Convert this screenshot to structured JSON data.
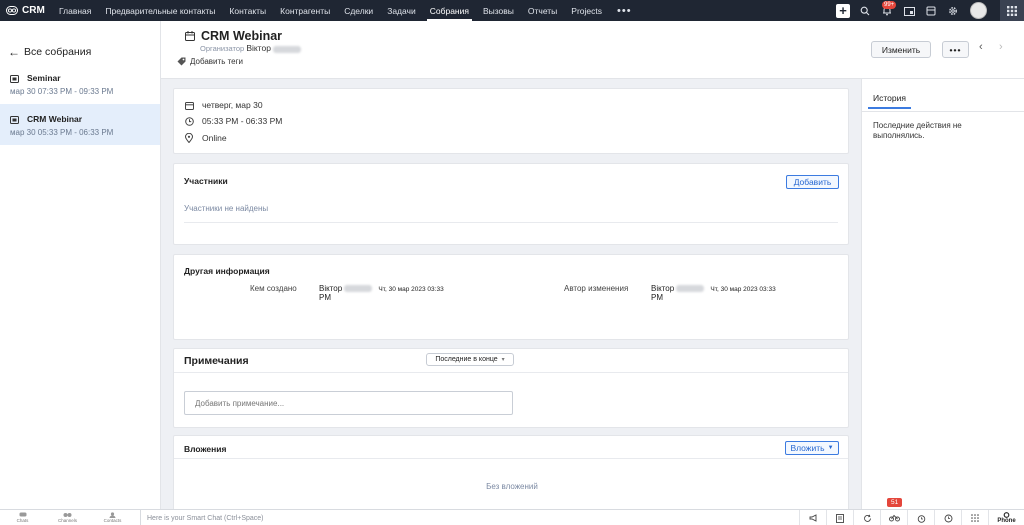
{
  "app": {
    "name": "CRM"
  },
  "nav": {
    "items": [
      {
        "label": "Главная"
      },
      {
        "label": "Предварительные контакты"
      },
      {
        "label": "Контакты"
      },
      {
        "label": "Контрагенты"
      },
      {
        "label": "Сделки"
      },
      {
        "label": "Задачи"
      },
      {
        "label": "Собрания"
      },
      {
        "label": "Вызовы"
      },
      {
        "label": "Отчеты"
      },
      {
        "label": "Projects"
      }
    ],
    "active_index": 6,
    "more": "•••"
  },
  "topbar": {
    "notifications_badge": "99+",
    "add_symbol": "+"
  },
  "left_panel": {
    "back_label": "Все собрания",
    "items": [
      {
        "title": "Seminar",
        "time": "мар 30 07:33 PM - 09:33 PM"
      },
      {
        "title": "CRM Webinar",
        "time": "мар 30 05:33 PM - 06:33 PM"
      }
    ]
  },
  "header": {
    "title": "CRM Webinar",
    "owner_label": "Организатор",
    "owner_name": "Віктор",
    "add_tags": "Добавить теги",
    "edit_button": "Изменить",
    "more_button": "•••",
    "prev_arrow": "‹",
    "next_arrow": "›"
  },
  "details": {
    "date": "четверг, мар 30",
    "time": "05:33 PM - 06:33 PM",
    "location": "Online"
  },
  "participants": {
    "title": "Участники",
    "add_button": "Добавить",
    "empty": "Участники не найдены"
  },
  "other_info": {
    "title": "Другая информация",
    "created_by_label": "Кем создано",
    "created_by_name": "Віктор",
    "created_by_date": "Чт, 30 мар 2023 03:33",
    "created_by_pm": "PM",
    "modified_by_label": "Автор изменения",
    "modified_by_name": "Віктор",
    "modified_by_date": "Чт, 30 мар 2023 03:33",
    "modified_by_pm": "PM"
  },
  "notes": {
    "title": "Примечания",
    "sort_label": "Последние в конце",
    "placeholder": "Добавить примечание..."
  },
  "attachments": {
    "title": "Вложения",
    "attach_button": "Вложить",
    "empty": "Без вложений"
  },
  "right_panel": {
    "tab": "История",
    "empty": "Последние действия не выполнялись."
  },
  "bottom_bar": {
    "items": [
      {
        "label": "Chats"
      },
      {
        "label": "Channels"
      },
      {
        "label": "Contacts"
      }
    ],
    "chat_placeholder": "Here is your Smart Chat (Ctrl+Space)",
    "badge": "51",
    "phone_label": "Phone"
  }
}
